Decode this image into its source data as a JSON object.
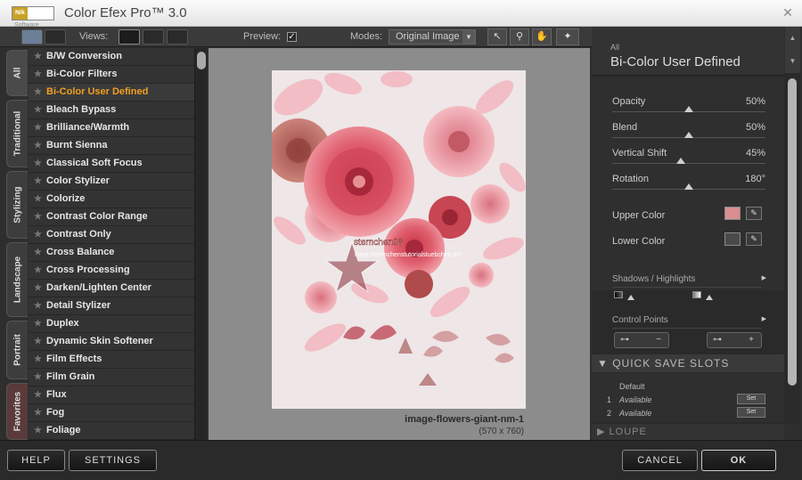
{
  "app": {
    "logo_brand": "Nik",
    "logo_sub": "Software",
    "title": "Color Efex Pro™ 3.0"
  },
  "toolbar": {
    "views_label": "Views:",
    "preview_label": "Preview:",
    "preview_checked": "✓",
    "modes_label": "Modes:",
    "modes_value": "Original Image",
    "icons": {
      "arrow": "pointer-icon",
      "zoom": "zoom-icon",
      "hand": "hand-icon",
      "light": "loupe-light-icon"
    }
  },
  "tabs": [
    "All",
    "Traditional",
    "Stylizing",
    "Landscape",
    "Portrait",
    "Favorites"
  ],
  "filters": [
    "B/W Conversion",
    "Bi-Color Filters",
    "Bi-Color User Defined",
    "Bleach Bypass",
    "Brilliance/Warmth",
    "Burnt Sienna",
    "Classical Soft Focus",
    "Color Stylizer",
    "Colorize",
    "Contrast Color Range",
    "Contrast Only",
    "Cross Balance",
    "Cross Processing",
    "Darken/Lighten Center",
    "Detail Stylizer",
    "Duplex",
    "Dynamic Skin Softener",
    "Film Effects",
    "Film Grain",
    "Flux",
    "Fog",
    "Foliage"
  ],
  "selected_filter": "Bi-Color User Defined",
  "preview": {
    "watermark_name": "sternchen08",
    "watermark_url": "https://sternchenstutorialstuebchen.de/",
    "caption": "image-flowers-giant-nm-1",
    "dimensions": "(570 x 760)"
  },
  "panel": {
    "category": "All",
    "title": "Bi-Color User Defined",
    "params": [
      {
        "label": "Opacity",
        "value": "50%",
        "level": 50
      },
      {
        "label": "Blend",
        "value": "50%",
        "level": 50
      },
      {
        "label": "Vertical Shift",
        "value": "45%",
        "level": 45
      },
      {
        "label": "Rotation",
        "value": "180°",
        "level": 50
      }
    ],
    "upper_color_label": "Upper Color",
    "upper_color": "#d98e90",
    "lower_color_label": "Lower Color",
    "lower_color": "#4a4a4a",
    "shadows_label": "Shadows / Highlights",
    "control_points_label": "Control Points",
    "quick_save_label": "QUICK SAVE SLOTS",
    "quick_save_default": "Default",
    "quick_save_slots": [
      {
        "num": "1",
        "status": "Available",
        "set": "Set"
      },
      {
        "num": "2",
        "status": "Available",
        "set": "Set"
      }
    ],
    "loupe_label": "LOUPE"
  },
  "buttons": {
    "help": "HELP",
    "settings": "SETTINGS",
    "cancel": "CANCEL",
    "ok": "OK"
  }
}
